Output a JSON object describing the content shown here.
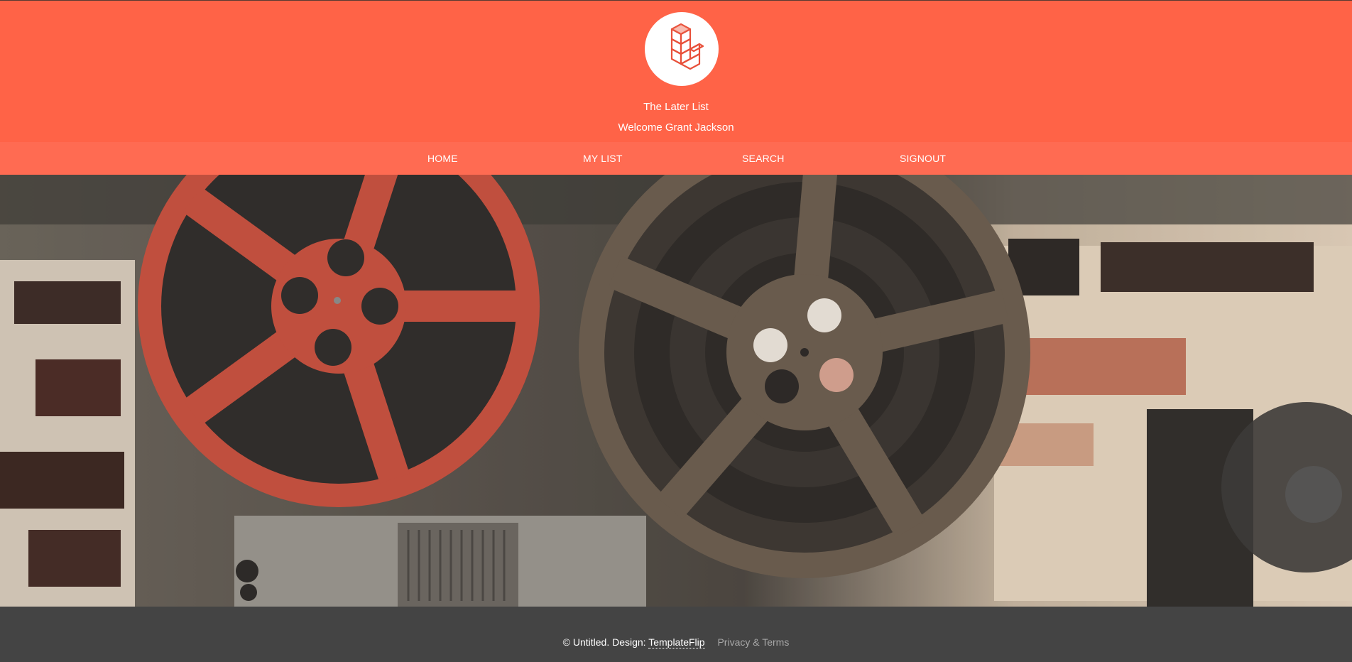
{
  "header": {
    "logo_icon": "stacked-cubes-icon",
    "site_title": "The Later List",
    "welcome": "Welcome Grant Jackson",
    "brand_color": "#ff6347"
  },
  "nav": {
    "items": [
      {
        "label": "HOME"
      },
      {
        "label": "MY LIST"
      },
      {
        "label": "SEARCH"
      },
      {
        "label": "SIGNOUT"
      }
    ],
    "bg_color": "#ff6b52"
  },
  "hero": {
    "image": "film-reels-photo"
  },
  "footer": {
    "copyright": "© Untitled. Design:",
    "design_link": "TemplateFlip",
    "privacy_link": "Privacy & Terms",
    "bg_color": "#444444"
  }
}
